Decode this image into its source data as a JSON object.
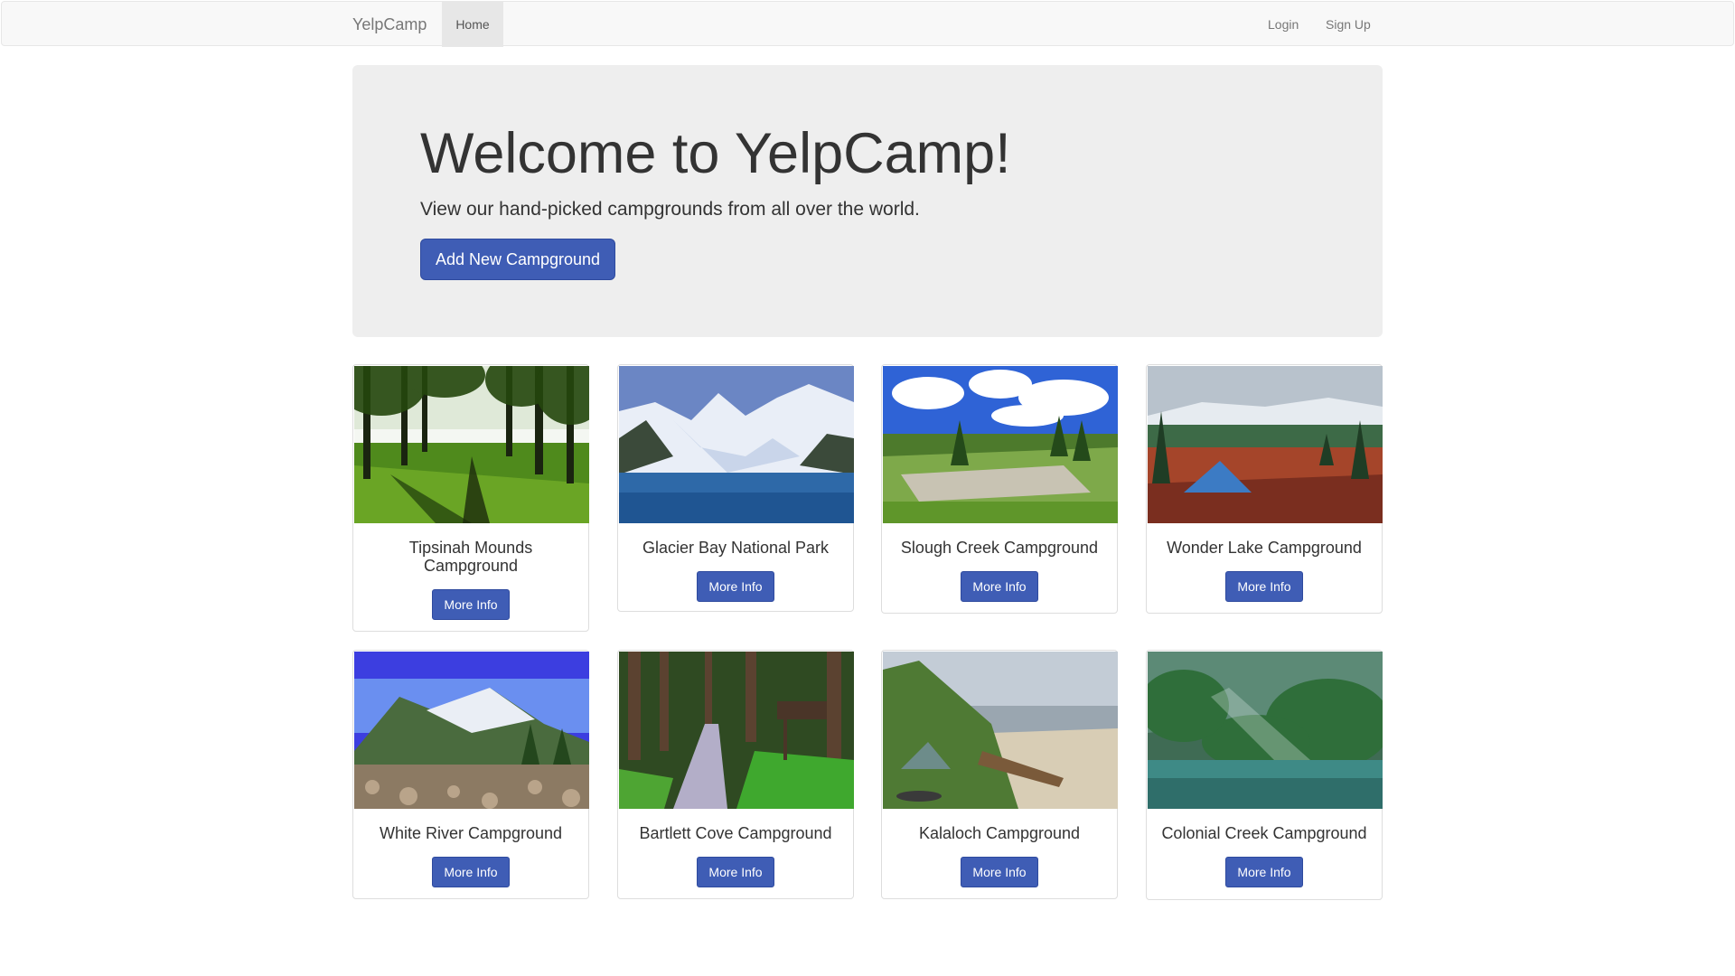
{
  "navbar": {
    "brand": "YelpCamp",
    "home": "Home",
    "login": "Login",
    "signup": "Sign Up"
  },
  "jumbotron": {
    "title": "Welcome to YelpCamp!",
    "subtitle": "View our hand-picked campgrounds from all over the world.",
    "button": "Add New Campground"
  },
  "colors": {
    "primary": "#3f5db5",
    "navbar_bg": "#f8f8f8",
    "jumbotron_bg": "#eeeeee"
  },
  "campgrounds": [
    {
      "name": "Tipsinah Mounds Campground",
      "button": "More Info",
      "image": "forest-lake-photo"
    },
    {
      "name": "Glacier Bay National Park",
      "button": "More Info",
      "image": "glacier-mountains-photo"
    },
    {
      "name": "Slough Creek Campground",
      "button": "More Info",
      "image": "meadow-clouds-photo"
    },
    {
      "name": "Wonder Lake Campground",
      "button": "More Info",
      "image": "tent-tundra-photo"
    },
    {
      "name": "White River Campground",
      "button": "More Info",
      "image": "snow-peak-river-photo"
    },
    {
      "name": "Bartlett Cove Campground",
      "button": "More Info",
      "image": "forest-trail-photo"
    },
    {
      "name": "Kalaloch Campground",
      "button": "More Info",
      "image": "beach-tent-photo"
    },
    {
      "name": "Colonial Creek Campground",
      "button": "More Info",
      "image": "misty-lake-photo"
    }
  ]
}
